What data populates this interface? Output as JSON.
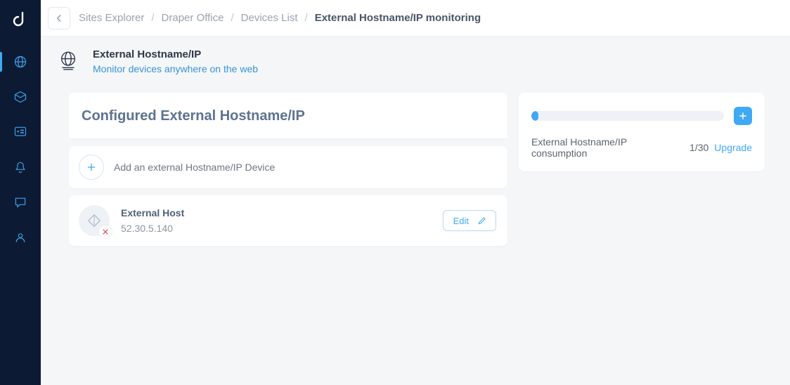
{
  "breadcrumbs": {
    "items": [
      {
        "label": "Sites Explorer"
      },
      {
        "label": "Draper Office"
      },
      {
        "label": "Devices List"
      }
    ],
    "current": "External Hostname/IP monitoring"
  },
  "page": {
    "title": "External Hostname/IP",
    "subtitle": "Monitor devices anywhere on the web"
  },
  "left": {
    "card_title": "Configured External Hostname/IP",
    "add_label": "Add an external Hostname/IP Device",
    "devices": [
      {
        "name": "External Host",
        "ip": "52.30.5.140",
        "status": "down"
      }
    ],
    "edit_label": "Edit"
  },
  "consumption": {
    "label": "External Hostname/IP consumption",
    "used": 1,
    "total": 30,
    "display": "1/30",
    "upgrade_label": "Upgrade",
    "fill_percent": 3.5
  },
  "sidebar": {
    "logo": "d",
    "items": [
      {
        "name": "globe",
        "active": true
      },
      {
        "name": "box"
      },
      {
        "name": "dashboard"
      },
      {
        "name": "bell"
      },
      {
        "name": "chat"
      },
      {
        "name": "profile"
      }
    ]
  }
}
